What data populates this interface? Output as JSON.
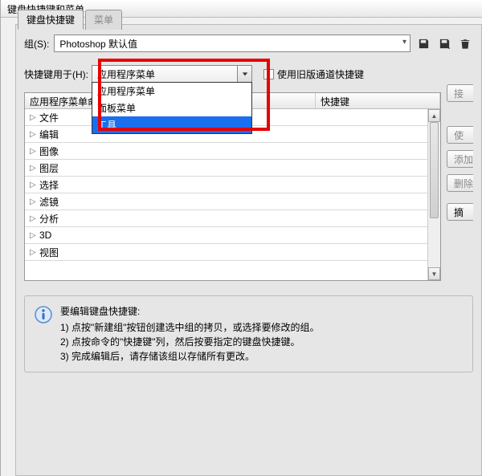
{
  "window": {
    "title": "键盘快捷键和菜单"
  },
  "tabs": {
    "shortcuts": "键盘快捷键",
    "menus": "菜单"
  },
  "set": {
    "label": "组(S):",
    "value": "Photoshop 默认值"
  },
  "shortcut_for": {
    "label": "快捷键用于(H):",
    "value": "应用程序菜单",
    "options": [
      "应用程序菜单",
      "面板菜单",
      "工具"
    ],
    "selected_index": 2
  },
  "legacy": {
    "label": "使用旧版通道快捷键"
  },
  "table": {
    "col_command": "应用程序菜单命令",
    "col_shortcut": "快捷键",
    "rows": [
      {
        "label": "文件"
      },
      {
        "label": "编辑"
      },
      {
        "label": "图像"
      },
      {
        "label": "图层"
      },
      {
        "label": "选择"
      },
      {
        "label": "滤镜"
      },
      {
        "label": "分析"
      },
      {
        "label": "3D"
      },
      {
        "label": "视图"
      }
    ]
  },
  "buttons": {
    "accept": "接",
    "use_default": "使",
    "add": "添加",
    "delete": "删除",
    "summary": "摘"
  },
  "info": {
    "title": "要编辑键盘快捷键:",
    "line1": "1) 点按\"新建组\"按钮创建选中组的拷贝，或选择要修改的组。",
    "line2": "2) 点按命令的\"快捷键\"列，然后按要指定的键盘快捷键。",
    "line3": "3) 完成编辑后，请存储该组以存储所有更改。"
  },
  "icons": {
    "save": "save-icon",
    "save_as": "save-as-icon",
    "delete": "trash-icon",
    "info": "info-icon"
  }
}
